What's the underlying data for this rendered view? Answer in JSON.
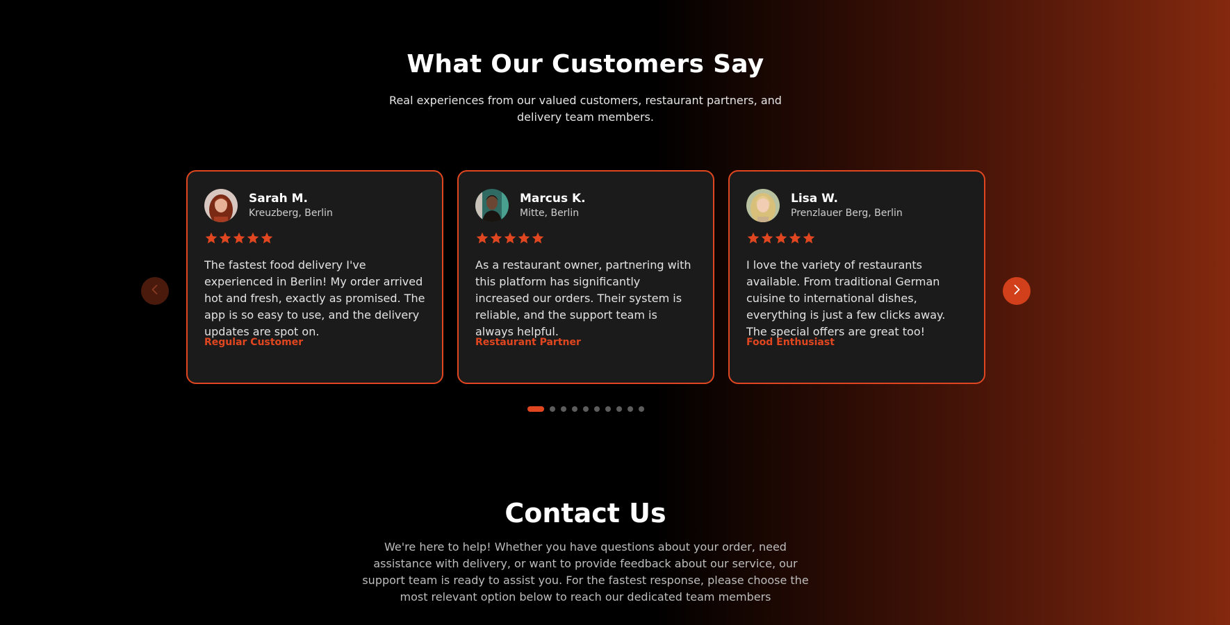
{
  "testimonials": {
    "title": "What Our Customers Say",
    "subtitle": "Real experiences from our valued customers, restaurant partners, and delivery team members.",
    "cards": [
      {
        "name": "Sarah M.",
        "location": "Kreuzberg, Berlin",
        "rating": 5,
        "quote": "The fastest food delivery I've experienced in Berlin! My order arrived hot and fresh, exactly as promised. The app is so easy to use, and the delivery updates are spot on.",
        "role": "Regular Customer"
      },
      {
        "name": "Marcus K.",
        "location": "Mitte, Berlin",
        "rating": 5,
        "quote": "As a restaurant owner, partnering with this platform has significantly increased our orders. Their system is reliable, and the support team is always helpful.",
        "role": "Restaurant Partner"
      },
      {
        "name": "Lisa W.",
        "location": "Prenzlauer Berg, Berlin",
        "rating": 5,
        "quote": "I love the variety of restaurants available. From traditional German cuisine to international dishes, everything is just a few clicks away. The special offers are great too!",
        "role": "Food Enthusiast"
      }
    ],
    "pagination": {
      "total_pages": 10,
      "current_page": 1
    },
    "icons": {
      "prev": "chevron-left-icon",
      "next": "chevron-right-icon",
      "star": "star-icon"
    }
  },
  "contact": {
    "title": "Contact Us",
    "body": "We're here to help! Whether you have questions about your order, need assistance with delivery, or want to provide feedback about our service, our support team is ready to assist you. For the fastest response, please choose the most relevant option below to reach our dedicated team members"
  },
  "colors": {
    "accent": "#e0461f",
    "card_background": "#1b1b1b",
    "page_background": "#000000",
    "gradient_end": "#84290f"
  }
}
